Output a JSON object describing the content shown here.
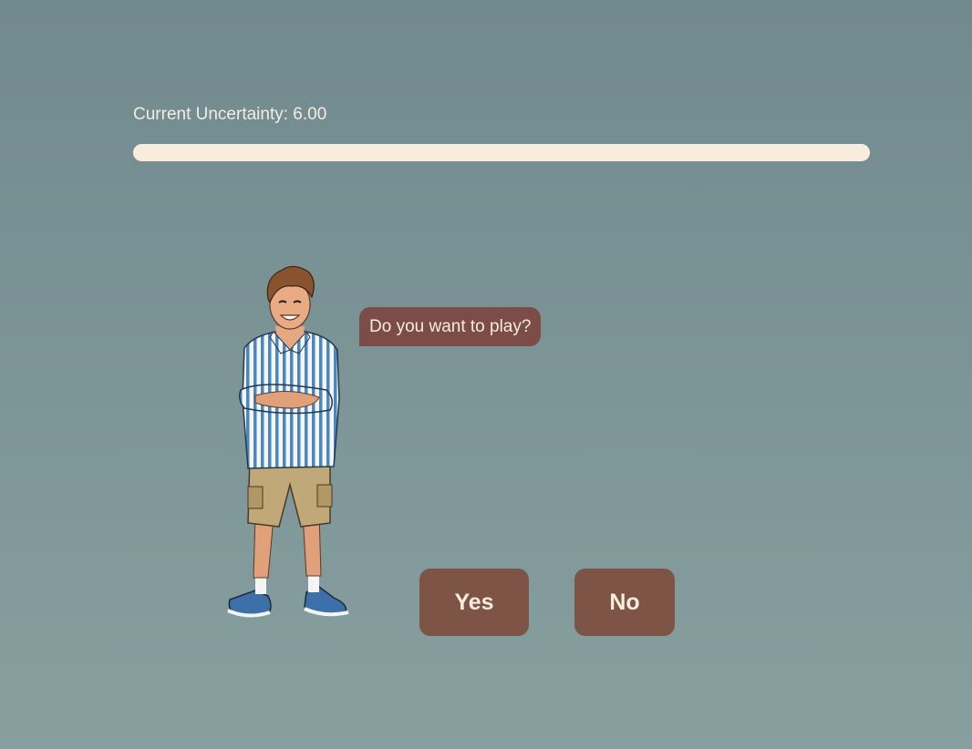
{
  "status": {
    "uncertainty_label": "Current Uncertainty: 6.00",
    "progress_fraction": 1.0
  },
  "character": {
    "icon": "smiling-man-character-icon"
  },
  "dialog": {
    "question": "Do you want to play?"
  },
  "buttons": {
    "yes_label": "Yes",
    "no_label": "No"
  },
  "colors": {
    "background_top": "#718a8e",
    "background_bottom": "#879f9f",
    "progress_bar": "#f8ecdc",
    "speech_bubble": "#7c4c48",
    "button": "#7d5445",
    "text_light": "#f8ecdc"
  }
}
